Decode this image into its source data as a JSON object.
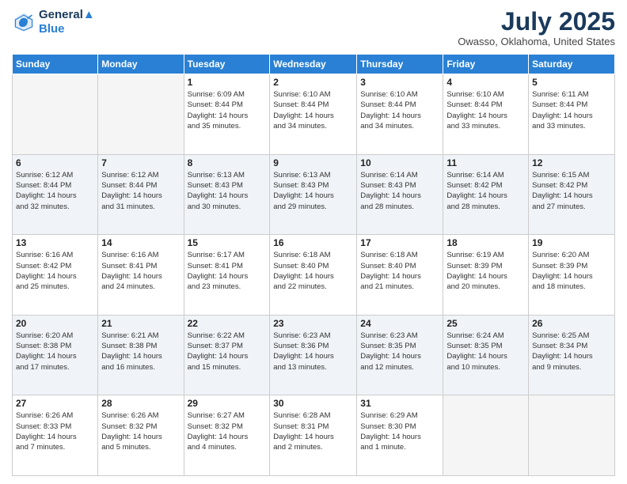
{
  "header": {
    "logo_line1": "General",
    "logo_line2": "Blue",
    "month": "July 2025",
    "location": "Owasso, Oklahoma, United States"
  },
  "weekdays": [
    "Sunday",
    "Monday",
    "Tuesday",
    "Wednesday",
    "Thursday",
    "Friday",
    "Saturday"
  ],
  "weeks": [
    [
      {
        "day": "",
        "detail": ""
      },
      {
        "day": "",
        "detail": ""
      },
      {
        "day": "1",
        "detail": "Sunrise: 6:09 AM\nSunset: 8:44 PM\nDaylight: 14 hours\nand 35 minutes."
      },
      {
        "day": "2",
        "detail": "Sunrise: 6:10 AM\nSunset: 8:44 PM\nDaylight: 14 hours\nand 34 minutes."
      },
      {
        "day": "3",
        "detail": "Sunrise: 6:10 AM\nSunset: 8:44 PM\nDaylight: 14 hours\nand 34 minutes."
      },
      {
        "day": "4",
        "detail": "Sunrise: 6:10 AM\nSunset: 8:44 PM\nDaylight: 14 hours\nand 33 minutes."
      },
      {
        "day": "5",
        "detail": "Sunrise: 6:11 AM\nSunset: 8:44 PM\nDaylight: 14 hours\nand 33 minutes."
      }
    ],
    [
      {
        "day": "6",
        "detail": "Sunrise: 6:12 AM\nSunset: 8:44 PM\nDaylight: 14 hours\nand 32 minutes."
      },
      {
        "day": "7",
        "detail": "Sunrise: 6:12 AM\nSunset: 8:44 PM\nDaylight: 14 hours\nand 31 minutes."
      },
      {
        "day": "8",
        "detail": "Sunrise: 6:13 AM\nSunset: 8:43 PM\nDaylight: 14 hours\nand 30 minutes."
      },
      {
        "day": "9",
        "detail": "Sunrise: 6:13 AM\nSunset: 8:43 PM\nDaylight: 14 hours\nand 29 minutes."
      },
      {
        "day": "10",
        "detail": "Sunrise: 6:14 AM\nSunset: 8:43 PM\nDaylight: 14 hours\nand 28 minutes."
      },
      {
        "day": "11",
        "detail": "Sunrise: 6:14 AM\nSunset: 8:42 PM\nDaylight: 14 hours\nand 28 minutes."
      },
      {
        "day": "12",
        "detail": "Sunrise: 6:15 AM\nSunset: 8:42 PM\nDaylight: 14 hours\nand 27 minutes."
      }
    ],
    [
      {
        "day": "13",
        "detail": "Sunrise: 6:16 AM\nSunset: 8:42 PM\nDaylight: 14 hours\nand 25 minutes."
      },
      {
        "day": "14",
        "detail": "Sunrise: 6:16 AM\nSunset: 8:41 PM\nDaylight: 14 hours\nand 24 minutes."
      },
      {
        "day": "15",
        "detail": "Sunrise: 6:17 AM\nSunset: 8:41 PM\nDaylight: 14 hours\nand 23 minutes."
      },
      {
        "day": "16",
        "detail": "Sunrise: 6:18 AM\nSunset: 8:40 PM\nDaylight: 14 hours\nand 22 minutes."
      },
      {
        "day": "17",
        "detail": "Sunrise: 6:18 AM\nSunset: 8:40 PM\nDaylight: 14 hours\nand 21 minutes."
      },
      {
        "day": "18",
        "detail": "Sunrise: 6:19 AM\nSunset: 8:39 PM\nDaylight: 14 hours\nand 20 minutes."
      },
      {
        "day": "19",
        "detail": "Sunrise: 6:20 AM\nSunset: 8:39 PM\nDaylight: 14 hours\nand 18 minutes."
      }
    ],
    [
      {
        "day": "20",
        "detail": "Sunrise: 6:20 AM\nSunset: 8:38 PM\nDaylight: 14 hours\nand 17 minutes."
      },
      {
        "day": "21",
        "detail": "Sunrise: 6:21 AM\nSunset: 8:38 PM\nDaylight: 14 hours\nand 16 minutes."
      },
      {
        "day": "22",
        "detail": "Sunrise: 6:22 AM\nSunset: 8:37 PM\nDaylight: 14 hours\nand 15 minutes."
      },
      {
        "day": "23",
        "detail": "Sunrise: 6:23 AM\nSunset: 8:36 PM\nDaylight: 14 hours\nand 13 minutes."
      },
      {
        "day": "24",
        "detail": "Sunrise: 6:23 AM\nSunset: 8:35 PM\nDaylight: 14 hours\nand 12 minutes."
      },
      {
        "day": "25",
        "detail": "Sunrise: 6:24 AM\nSunset: 8:35 PM\nDaylight: 14 hours\nand 10 minutes."
      },
      {
        "day": "26",
        "detail": "Sunrise: 6:25 AM\nSunset: 8:34 PM\nDaylight: 14 hours\nand 9 minutes."
      }
    ],
    [
      {
        "day": "27",
        "detail": "Sunrise: 6:26 AM\nSunset: 8:33 PM\nDaylight: 14 hours\nand 7 minutes."
      },
      {
        "day": "28",
        "detail": "Sunrise: 6:26 AM\nSunset: 8:32 PM\nDaylight: 14 hours\nand 5 minutes."
      },
      {
        "day": "29",
        "detail": "Sunrise: 6:27 AM\nSunset: 8:32 PM\nDaylight: 14 hours\nand 4 minutes."
      },
      {
        "day": "30",
        "detail": "Sunrise: 6:28 AM\nSunset: 8:31 PM\nDaylight: 14 hours\nand 2 minutes."
      },
      {
        "day": "31",
        "detail": "Sunrise: 6:29 AM\nSunset: 8:30 PM\nDaylight: 14 hours\nand 1 minute."
      },
      {
        "day": "",
        "detail": ""
      },
      {
        "day": "",
        "detail": ""
      }
    ]
  ]
}
